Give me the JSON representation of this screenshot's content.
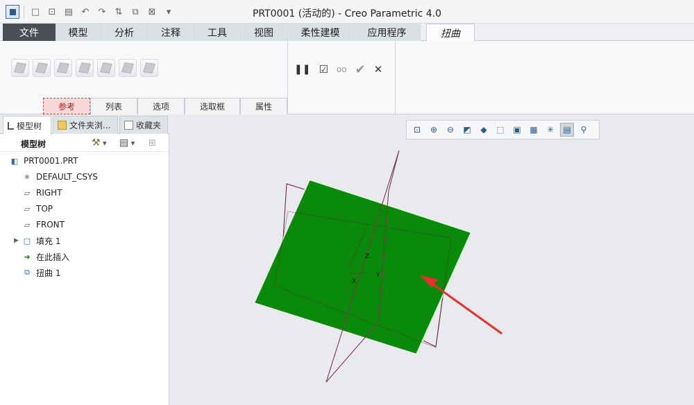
{
  "window": {
    "title": "PRT0001 (活动的) - Creo Parametric 4.0"
  },
  "quick_access": [
    {
      "name": "new-icon",
      "glyph": "□"
    },
    {
      "name": "open-icon",
      "glyph": "⊡"
    },
    {
      "name": "save-icon",
      "glyph": "▤"
    },
    {
      "name": "undo-icon",
      "glyph": "↶"
    },
    {
      "name": "redo-icon",
      "glyph": "↷"
    },
    {
      "name": "regenerate-icon",
      "glyph": "⇅"
    },
    {
      "name": "windows-icon",
      "glyph": "⧉"
    },
    {
      "name": "close-window-icon",
      "glyph": "⊠"
    },
    {
      "name": "customize-icon",
      "glyph": "▾"
    }
  ],
  "ribbon_tabs": [
    "文件",
    "模型",
    "分析",
    "注释",
    "工具",
    "视图",
    "柔性建模",
    "应用程序",
    "扭曲"
  ],
  "ribbon_subtabs": [
    "参考",
    "列表",
    "选项",
    "选取框",
    "属性"
  ],
  "geometry_tools": [
    "transform-icon",
    "warp-icon",
    "spine-icon",
    "stretch-icon",
    "bend-icon",
    "twist-icon",
    "sculpt-icon"
  ],
  "controls": {
    "pause": "❚❚",
    "preview_checkbox": "☑",
    "preview_glasses": "oo",
    "ok": "✔",
    "cancel": "✕"
  },
  "panel_tabs": [
    "模型树",
    "文件夹浏...",
    "收藏夹"
  ],
  "tree": {
    "header": "模型树",
    "items": [
      {
        "label": "PRT0001.PRT",
        "icon": "part-icon",
        "glyph": "◧",
        "expand": ""
      },
      {
        "label": "DEFAULT_CSYS",
        "icon": "csys-icon",
        "glyph": "✳",
        "expand": ""
      },
      {
        "label": "RIGHT",
        "icon": "datum-plane-icon",
        "glyph": "▱",
        "expand": ""
      },
      {
        "label": "TOP",
        "icon": "datum-plane-icon",
        "glyph": "▱",
        "expand": ""
      },
      {
        "label": "FRONT",
        "icon": "datum-plane-icon",
        "glyph": "▱",
        "expand": ""
      },
      {
        "label": "填充 1",
        "icon": "fill-icon",
        "glyph": "□",
        "expand": "▶"
      },
      {
        "label": "在此插入",
        "icon": "insert-here-icon",
        "glyph": "➜",
        "expand": ""
      },
      {
        "label": "扭曲 1",
        "icon": "warp-feature-icon",
        "glyph": "⧉",
        "expand": ""
      }
    ]
  },
  "view_toolbar": [
    {
      "name": "refit-icon",
      "glyph": "⊡"
    },
    {
      "name": "zoom-in-icon",
      "glyph": "⊕"
    },
    {
      "name": "zoom-out-icon",
      "glyph": "⊖"
    },
    {
      "name": "repaint-icon",
      "glyph": "◩"
    },
    {
      "name": "display-style-icon",
      "glyph": "◆"
    },
    {
      "name": "saved-orientations-icon",
      "glyph": "⬚"
    },
    {
      "name": "view-manager-icon",
      "glyph": "▣"
    },
    {
      "name": "perspective-icon",
      "glyph": "▦"
    },
    {
      "name": "datum-display-icon",
      "glyph": "✳"
    },
    {
      "name": "annotation-display-icon",
      "glyph": "▤"
    },
    {
      "name": "spin-center-icon",
      "glyph": "⚲"
    }
  ],
  "axis_labels": {
    "x": "X",
    "y": "Y",
    "z": "Z"
  },
  "colors": {
    "surface": "#0a8a0a",
    "datum": "#7a3a4a",
    "arrow": "#e8302a",
    "file_tab": "#4a4e55"
  }
}
